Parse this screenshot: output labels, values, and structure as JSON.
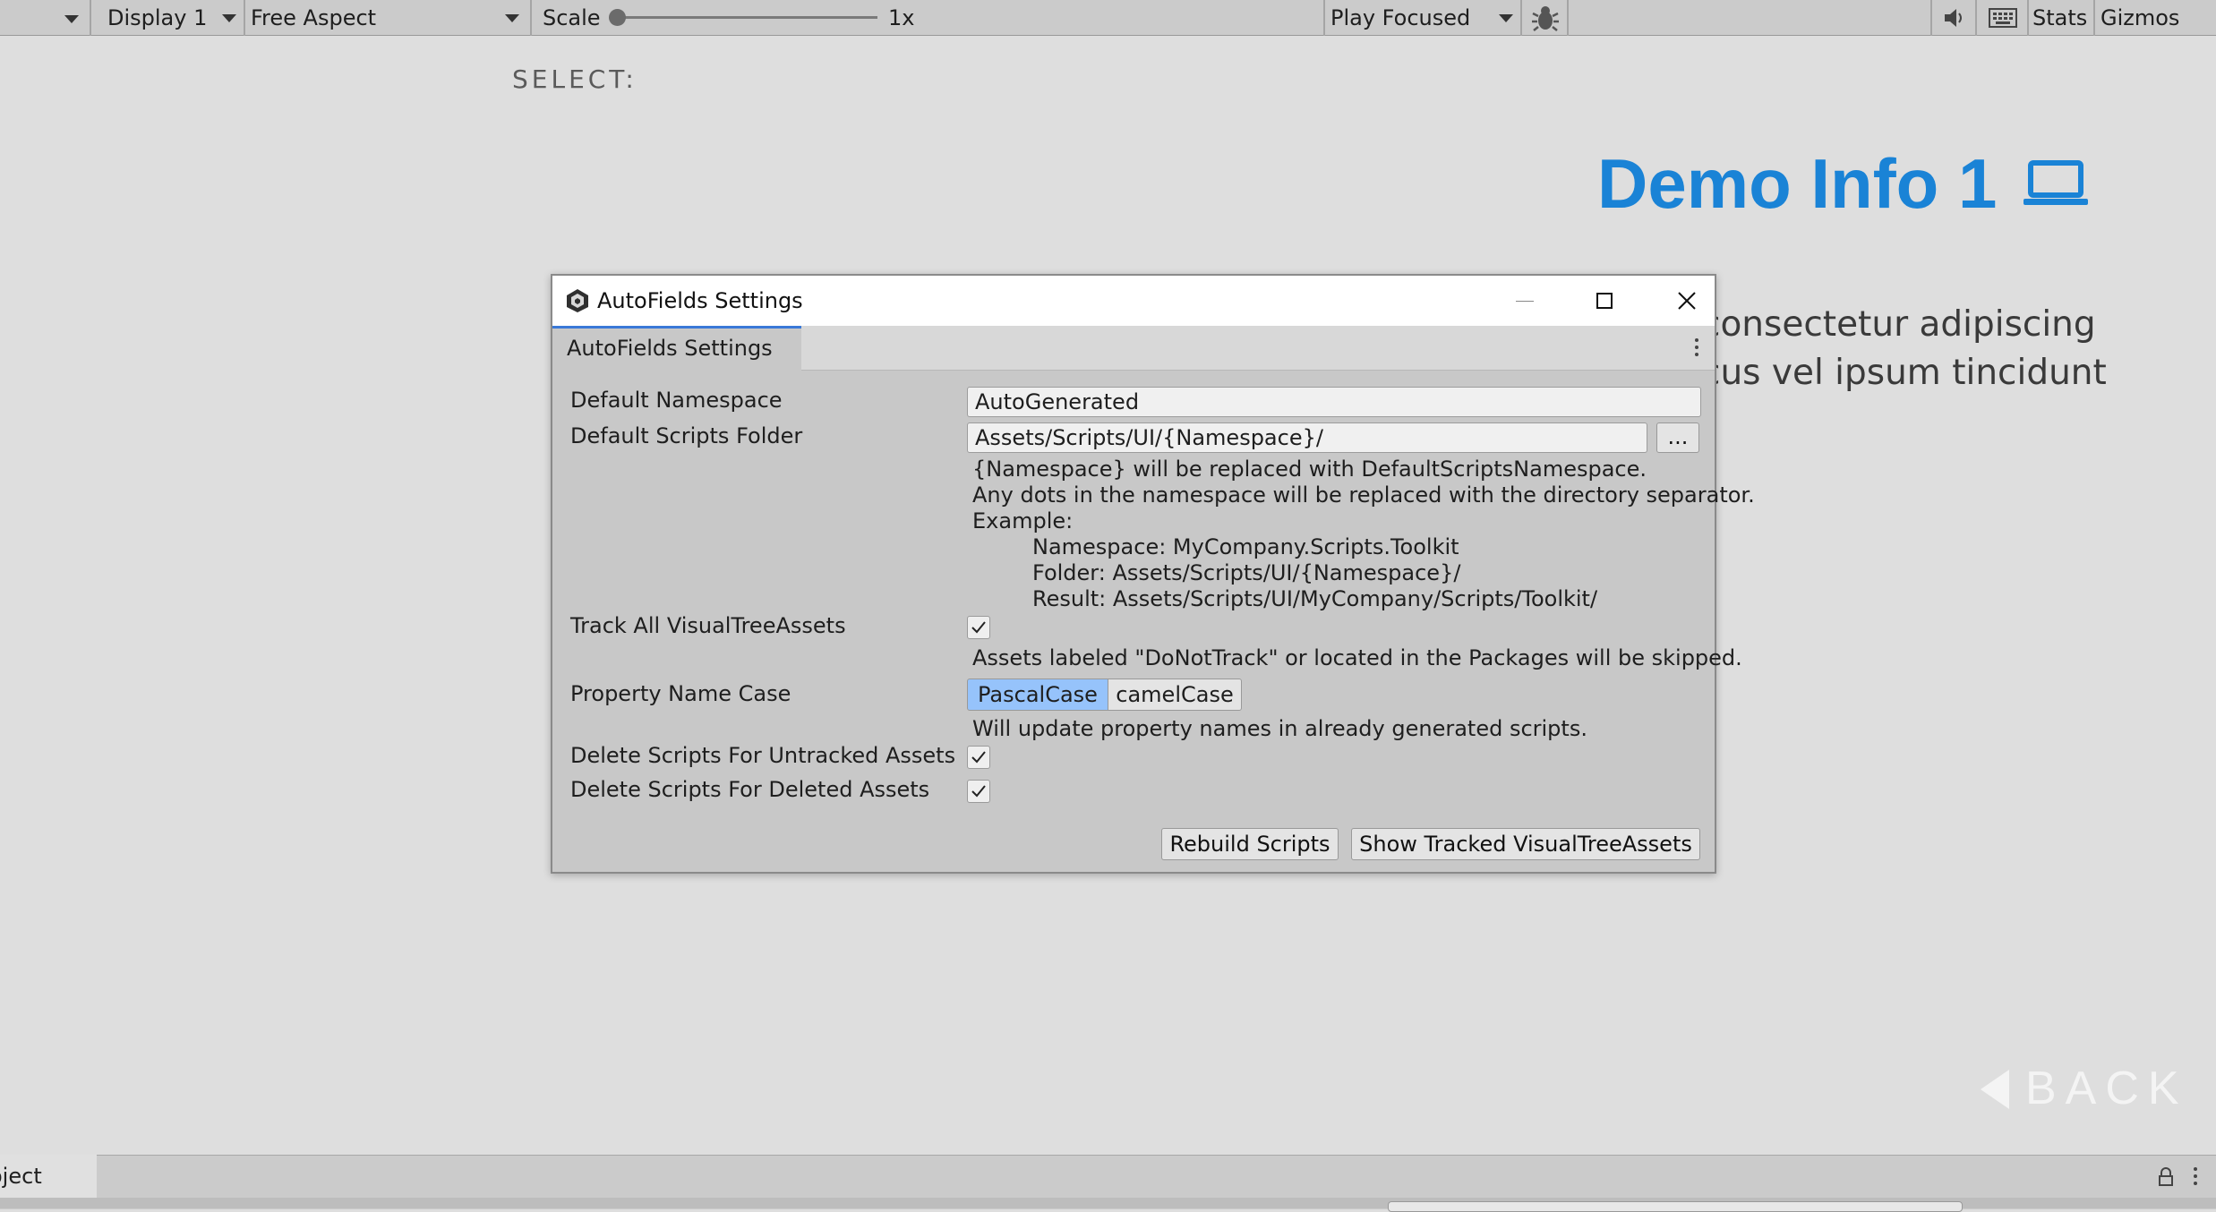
{
  "toolbar": {
    "display": "Display 1",
    "aspect": "Free Aspect",
    "scale_label": "Scale",
    "scale_value": "1x",
    "scale_level": 0.0,
    "play_mode": "Play Focused",
    "stats": "Stats",
    "gizmos": "Gizmos"
  },
  "game": {
    "select_label": "SELECT:",
    "title": "Demo Info 1",
    "body_line1": "consectetur adipiscing",
    "body_line2": "cus vel ipsum tincidunt",
    "back": "BACK",
    "accent_color": "#1a83d6"
  },
  "bottom": {
    "tab_label": "oject"
  },
  "window": {
    "title": "AutoFields Settings",
    "tab": "AutoFields Settings",
    "namespace": {
      "label": "Default Namespace",
      "value": "AutoGenerated"
    },
    "folder": {
      "label": "Default Scripts Folder",
      "value": "Assets/Scripts/UI/{Namespace}/",
      "browse": "...",
      "help1": "{Namespace} will be replaced with DefaultScriptsNamespace.",
      "help2": "Any dots in the namespace will be replaced with the directory separator.",
      "help3": "Example:",
      "help4": "Namespace: MyCompany.Scripts.Toolkit",
      "help5": "Folder: Assets/Scripts/UI/{Namespace}/",
      "help6": "Result: Assets/Scripts/UI/MyCompany/Scripts/Toolkit/"
    },
    "track_all": {
      "label": "Track All VisualTreeAssets",
      "checked": true,
      "help": "Assets labeled \"DoNotTrack\" or located in the Packages will be skipped."
    },
    "property_case": {
      "label": "Property Name Case",
      "options": [
        "PascalCase",
        "camelCase"
      ],
      "selected": "PascalCase",
      "selected_color": "#96c3fb",
      "help": "Will update property names in already generated scripts."
    },
    "delete_untracked": {
      "label": "Delete Scripts For Untracked Assets",
      "checked": true
    },
    "delete_deleted": {
      "label": "Delete Scripts For Deleted Assets",
      "checked": true
    },
    "rebuild_button": "Rebuild Scripts",
    "show_tracked_button": "Show Tracked VisualTreeAssets"
  }
}
